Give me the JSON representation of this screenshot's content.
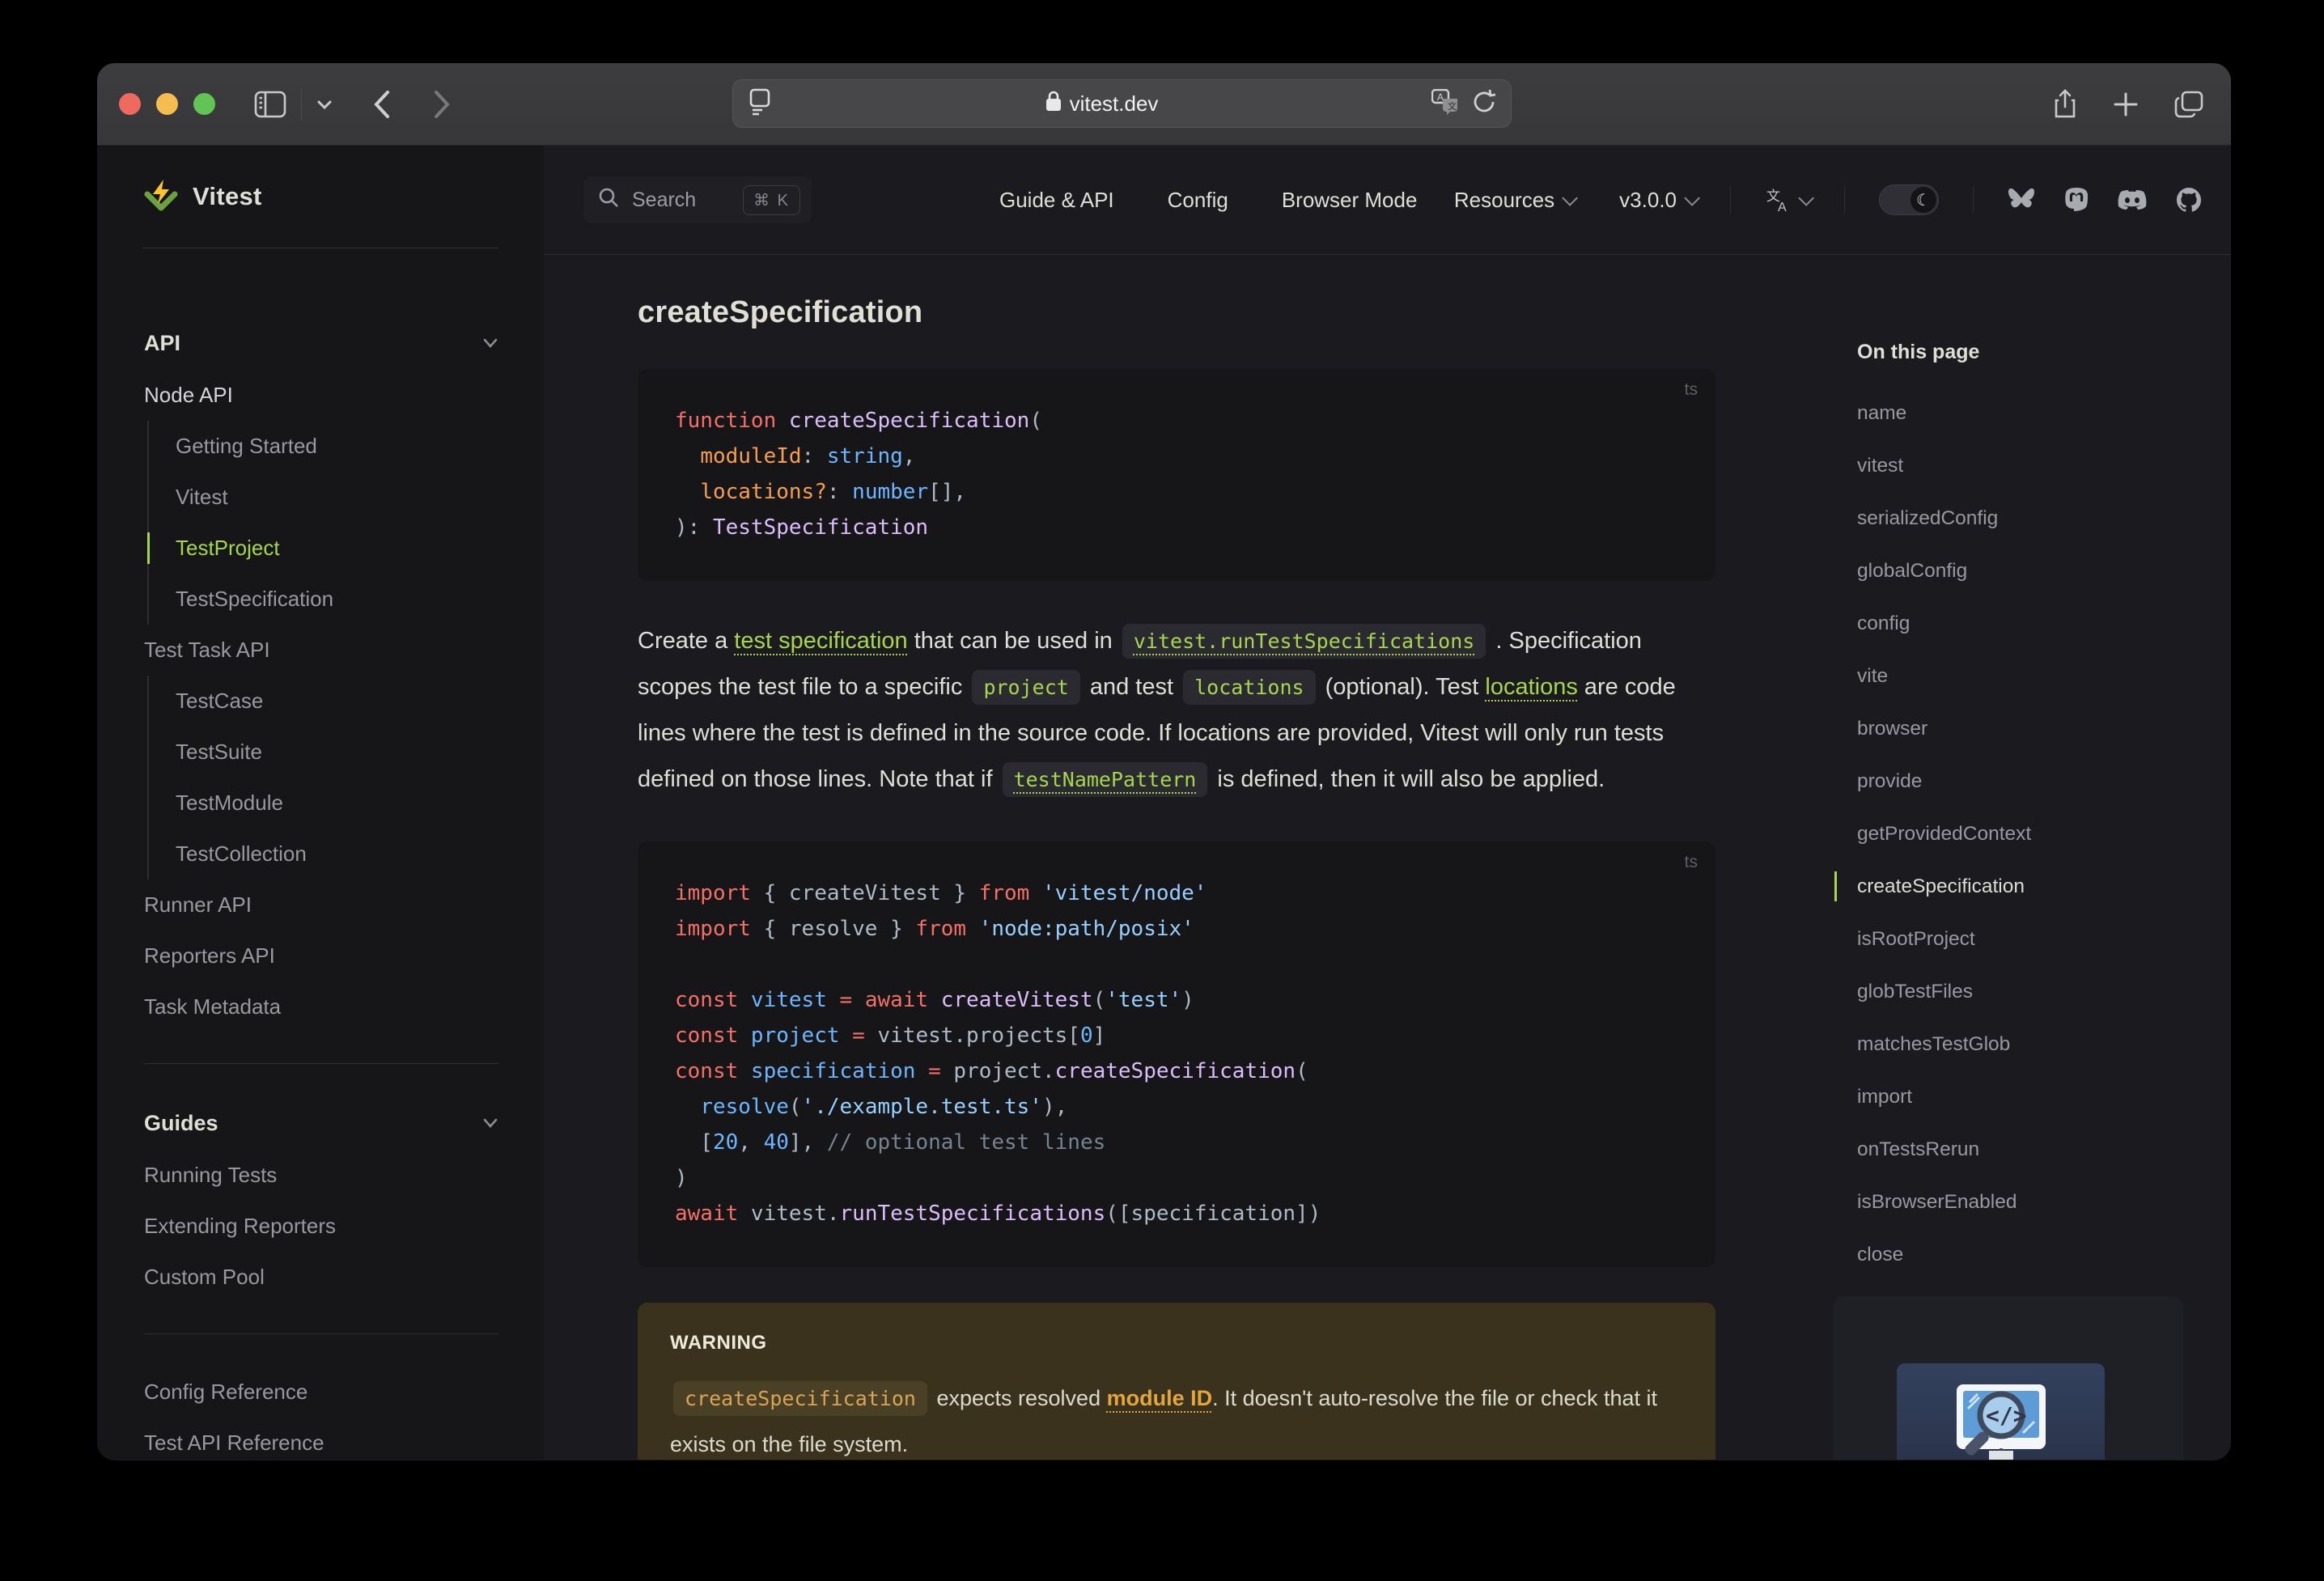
{
  "colors": {
    "accent_green": "#a6d64f",
    "warning_bg": "#3a321c",
    "warning_link": "#e2a63b",
    "code_bg": "#161618",
    "sidebar_bg": "#161618",
    "page_bg": "#1b1b1f"
  },
  "browser": {
    "url": "vitest.dev",
    "icons": [
      "sidebar-toggle",
      "chevron-down",
      "back",
      "forward",
      "reader",
      "lock",
      "translate",
      "reload",
      "share",
      "new-tab",
      "tabs-overview"
    ]
  },
  "nav": {
    "search": {
      "label": "Search",
      "kbd": "⌘ K"
    },
    "links": [
      "Guide & API",
      "Config",
      "Browser Mode"
    ],
    "dropdowns": [
      "Resources",
      "v3.0.0"
    ],
    "socials": [
      "bluesky",
      "mastodon",
      "discord",
      "github"
    ]
  },
  "sidebar": {
    "brand": "Vitest",
    "sections": [
      {
        "title": "API",
        "items": [
          {
            "label": "Node API",
            "indent": 0,
            "bright": true
          },
          {
            "label": "Getting Started",
            "indent": 1
          },
          {
            "label": "Vitest",
            "indent": 1
          },
          {
            "label": "TestProject",
            "indent": 1,
            "active": true
          },
          {
            "label": "TestSpecification",
            "indent": 1
          },
          {
            "label": "Test Task API",
            "indent": 0
          },
          {
            "label": "TestCase",
            "indent": 1
          },
          {
            "label": "TestSuite",
            "indent": 1
          },
          {
            "label": "TestModule",
            "indent": 1
          },
          {
            "label": "TestCollection",
            "indent": 1
          },
          {
            "label": "Runner API",
            "indent": 0
          },
          {
            "label": "Reporters API",
            "indent": 0
          },
          {
            "label": "Task Metadata",
            "indent": 0
          }
        ]
      },
      {
        "title": "Guides",
        "items": [
          {
            "label": "Running Tests",
            "indent": 0
          },
          {
            "label": "Extending Reporters",
            "indent": 0
          },
          {
            "label": "Custom Pool",
            "indent": 0
          }
        ]
      },
      {
        "title": "",
        "items": [
          {
            "label": "Config Reference",
            "indent": 0
          },
          {
            "label": "Test API Reference",
            "indent": 0
          }
        ]
      }
    ]
  },
  "page": {
    "h1": "createSpecification",
    "code1": {
      "lang": "ts",
      "lines": [
        [
          [
            "kw",
            "function "
          ],
          [
            "fn",
            "createSpecification"
          ],
          [
            "fg",
            "("
          ]
        ],
        [
          [
            "fg",
            "  "
          ],
          [
            "prm",
            "moduleId"
          ],
          [
            "fg",
            ": "
          ],
          [
            "var",
            "string"
          ],
          [
            "fg",
            ","
          ]
        ],
        [
          [
            "fg",
            "  "
          ],
          [
            "prm",
            "locations?"
          ],
          [
            "fg",
            ": "
          ],
          [
            "var",
            "number"
          ],
          [
            "fg",
            "[],"
          ]
        ],
        [
          [
            "fg",
            "): "
          ],
          [
            "fn",
            "TestSpecification"
          ]
        ]
      ]
    },
    "paragraph": [
      {
        "t": "text",
        "v": "Create a "
      },
      {
        "t": "link",
        "v": "test specification"
      },
      {
        "t": "text",
        "v": " that can be used in "
      },
      {
        "t": "codelink",
        "v": "vitest.runTestSpecifications"
      },
      {
        "t": "text",
        "v": " . Specification scopes the test file to a specific "
      },
      {
        "t": "code",
        "v": "project"
      },
      {
        "t": "text",
        "v": " and test "
      },
      {
        "t": "code",
        "v": "locations"
      },
      {
        "t": "text",
        "v": " (optional). Test "
      },
      {
        "t": "link",
        "v": "locations"
      },
      {
        "t": "text",
        "v": " are code lines where the test is defined in the source code. If locations are provided, Vitest will only run tests defined on those lines. Note that if "
      },
      {
        "t": "codelink",
        "v": "testNamePattern"
      },
      {
        "t": "text",
        "v": " is defined, then it will also be applied."
      }
    ],
    "code2": {
      "lang": "ts",
      "lines": [
        [
          [
            "kw",
            "import"
          ],
          [
            "fg",
            " { createVitest } "
          ],
          [
            "kw",
            "from"
          ],
          [
            "str",
            " 'vitest/node'"
          ]
        ],
        [
          [
            "kw",
            "import"
          ],
          [
            "fg",
            " { resolve } "
          ],
          [
            "kw",
            "from"
          ],
          [
            "str",
            " 'node:path/posix'"
          ]
        ],
        [],
        [
          [
            "kw",
            "const"
          ],
          [
            "var",
            " vitest"
          ],
          [
            "kw",
            " ="
          ],
          [
            "kw",
            " await"
          ],
          [
            "fn",
            " createVitest"
          ],
          [
            "fg",
            "("
          ],
          [
            "str",
            "'test'"
          ],
          [
            "fg",
            ")"
          ]
        ],
        [
          [
            "kw",
            "const"
          ],
          [
            "var",
            " project"
          ],
          [
            "kw",
            " ="
          ],
          [
            "fg",
            " vitest.projects["
          ],
          [
            "var",
            "0"
          ],
          [
            "fg",
            "]"
          ]
        ],
        [
          [
            "kw",
            "const"
          ],
          [
            "var",
            " specification"
          ],
          [
            "kw",
            " ="
          ],
          [
            "fg",
            " project."
          ],
          [
            "fn",
            "createSpecification"
          ],
          [
            "fg",
            "("
          ]
        ],
        [
          [
            "fg",
            "  "
          ],
          [
            "var",
            "resolve"
          ],
          [
            "fg",
            "("
          ],
          [
            "str",
            "'./example.test.ts'"
          ],
          [
            "fg",
            "),"
          ]
        ],
        [
          [
            "fg",
            "  ["
          ],
          [
            "var",
            "20"
          ],
          [
            "fg",
            ", "
          ],
          [
            "var",
            "40"
          ],
          [
            "fg",
            "], "
          ],
          [
            "cmt",
            "// optional test lines"
          ]
        ],
        [
          [
            "fg",
            ")"
          ]
        ],
        [
          [
            "kw",
            "await"
          ],
          [
            "fg",
            " vitest."
          ],
          [
            "fn",
            "runTestSpecifications"
          ],
          [
            "fg",
            "([specification])"
          ]
        ]
      ]
    },
    "warning": {
      "title": "WARNING",
      "body": [
        {
          "t": "code",
          "v": "createSpecification"
        },
        {
          "t": "text",
          "v": " expects resolved "
        },
        {
          "t": "link",
          "v": "module ID"
        },
        {
          "t": "text",
          "v": ". It doesn't auto-resolve the file or check that it exists on the file system."
        }
      ]
    }
  },
  "toc": {
    "title": "On this page",
    "items": [
      {
        "label": "name"
      },
      {
        "label": "vitest"
      },
      {
        "label": "serializedConfig"
      },
      {
        "label": "globalConfig"
      },
      {
        "label": "config"
      },
      {
        "label": "vite"
      },
      {
        "label": "browser"
      },
      {
        "label": "provide"
      },
      {
        "label": "getProvidedContext"
      },
      {
        "label": "createSpecification",
        "active": true
      },
      {
        "label": "isRootProject"
      },
      {
        "label": "globTestFiles"
      },
      {
        "label": "matchesTestGlob"
      },
      {
        "label": "import"
      },
      {
        "label": "onTestsRerun"
      },
      {
        "label": "isBrowserEnabled"
      },
      {
        "label": "close"
      }
    ]
  }
}
